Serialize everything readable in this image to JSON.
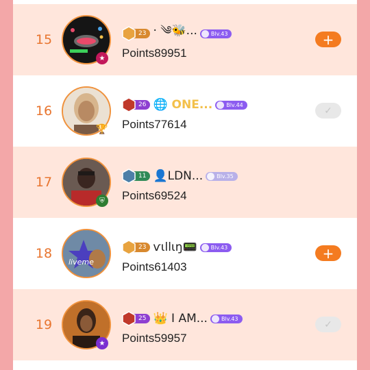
{
  "rows": [
    {
      "rank": "15",
      "level": "23",
      "level_color": "#d8892f",
      "name": "· ༄🐝...",
      "name_style": "normal",
      "blv": "Blv.43",
      "points": "Points89951",
      "action": "add",
      "action_label": "+",
      "avatar_bg": "#1a1a1a",
      "badge_color": "#c2185b"
    },
    {
      "rank": "16",
      "level": "26",
      "level_color": "#8e3fd1",
      "name": "🌐 ONE...",
      "name_style": "gold",
      "blv": "Blv.44",
      "points": "Points77614",
      "action": "done",
      "action_label": "✓",
      "avatar_bg": "#d9b08c",
      "badge_color": "#d8a13a"
    },
    {
      "rank": "17",
      "level": "11",
      "level_color": "#2f8a57",
      "name": "👤LDN...",
      "name_style": "normal",
      "blv": "Blv.35",
      "points": "Points69524",
      "action": "none",
      "action_label": "",
      "avatar_bg": "#3b2b25",
      "badge_color": "#2e7d32"
    },
    {
      "rank": "18",
      "level": "23",
      "level_color": "#d8892f",
      "name": "ѵιllιŋ📟",
      "name_style": "normal",
      "blv": "Blv.43",
      "points": "Points61403",
      "action": "add",
      "action_label": "+",
      "avatar_bg": "#4a6a8a",
      "badge_color": "#4b3fbf"
    },
    {
      "rank": "19",
      "level": "25",
      "level_color": "#8e3fd1",
      "name": "👑 I AM...",
      "name_style": "normal",
      "blv": "Blv.43",
      "points": "Points59957",
      "action": "done",
      "action_label": "✓",
      "avatar_bg": "#8a4a1e",
      "badge_color": "#7b2fd1"
    }
  ],
  "colors": {
    "accent": "#f47b20",
    "rank": "#e8752f",
    "row_alt": "#ffe6dc",
    "page_side": "#f3a7a8",
    "blv_purple": "#8c5cf0"
  }
}
